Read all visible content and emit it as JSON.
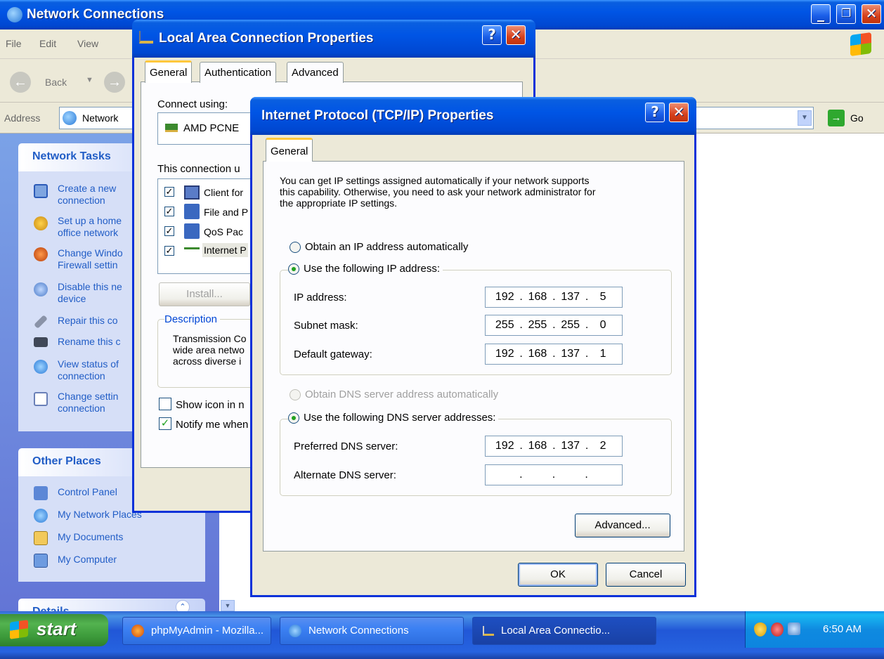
{
  "network_connections": {
    "title": "Network Connections",
    "menu": [
      "File",
      "Edit",
      "View"
    ],
    "toolbar": {
      "back": "Back"
    },
    "address": {
      "label": "Address",
      "value": "Network",
      "go": "Go"
    },
    "network_tasks": {
      "header": "Network Tasks",
      "items": [
        [
          "Create a new",
          "connection"
        ],
        [
          "Set up a home",
          "office network"
        ],
        [
          "Change Windo",
          "Firewall settin"
        ],
        [
          "Disable this ne",
          "device"
        ],
        [
          "Repair this co",
          ""
        ],
        [
          "Rename this c",
          ""
        ],
        [
          "View status of",
          "connection"
        ],
        [
          "Change settin",
          "connection"
        ]
      ]
    },
    "other_places": {
      "header": "Other Places",
      "items": [
        "Control Panel",
        "My Network Places",
        "My Documents",
        "My Computer"
      ]
    },
    "details": {
      "header": "Details"
    }
  },
  "lac_dialog": {
    "title": "Local Area Connection Properties",
    "tabs": [
      "General",
      "Authentication",
      "Advanced"
    ],
    "connect_using_label": "Connect using:",
    "adapter": "AMD PCNE",
    "components_label": "This connection u",
    "components": [
      "Client for",
      "File and P",
      "QoS Pac",
      "Internet P"
    ],
    "install_button": "Install...",
    "description_label": "Description",
    "description_text": [
      "Transmission Co",
      "wide area netwo",
      "across diverse i"
    ],
    "show_icon": "Show icon in n",
    "notify": "Notify me when"
  },
  "tcp_dialog": {
    "title": "Internet Protocol (TCP/IP) Properties",
    "tab": "General",
    "intro": [
      "You can get IP settings assigned automatically if your network supports",
      "this capability. Otherwise, you need to ask your network administrator for",
      "the appropriate IP settings."
    ],
    "radio_auto_ip": "Obtain an IP address automatically",
    "radio_manual_ip": "Use the following IP address:",
    "ip_label": "IP address:",
    "ip_value": [
      "192",
      "168",
      "137",
      "5"
    ],
    "subnet_label": "Subnet mask:",
    "subnet_value": [
      "255",
      "255",
      "255",
      "0"
    ],
    "gateway_label": "Default gateway:",
    "gateway_value": [
      "192",
      "168",
      "137",
      "1"
    ],
    "radio_auto_dns": "Obtain DNS server address automatically",
    "radio_manual_dns": "Use the following DNS server addresses:",
    "pref_dns_label": "Preferred DNS server:",
    "pref_dns_value": [
      "192",
      "168",
      "137",
      "2"
    ],
    "alt_dns_label": "Alternate DNS server:",
    "alt_dns_value": [
      "",
      "",
      "",
      ""
    ],
    "advanced_button": "Advanced...",
    "ok_button": "OK",
    "cancel_button": "Cancel"
  },
  "taskbar": {
    "start": "start",
    "tasks": [
      "phpMyAdmin - Mozilla...",
      "Network Connections",
      "Local Area Connectio..."
    ],
    "clock": "6:50 AM"
  },
  "colors": {
    "title_blue": "#0055e5",
    "close_red": "#d6411c",
    "link_blue": "#215dc6",
    "dialog_face": "#ece9d8"
  }
}
